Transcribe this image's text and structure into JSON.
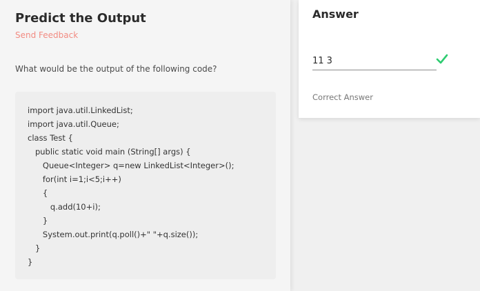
{
  "question_panel": {
    "title": "Predict the Output",
    "feedback_link": "Send Feedback",
    "question_text": "What would be the output of the following code?",
    "code_lines": [
      "import java.util.LinkedList;",
      "import java.util.Queue;",
      "class Test {",
      "   public static void main (String[] args) {",
      "      Queue<Integer> q=new LinkedList<Integer>();",
      "      for(int i=1;i<5;i++)",
      "      {",
      "         q.add(10+i);",
      "      }",
      "      System.out.print(q.poll()+\" \"+q.size());",
      "   }",
      "}"
    ]
  },
  "answer_panel": {
    "heading": "Answer",
    "answer_value": "11 3",
    "status_icon": "check-icon",
    "status_text": "Correct Answer",
    "success_color": "#2ecc71"
  }
}
